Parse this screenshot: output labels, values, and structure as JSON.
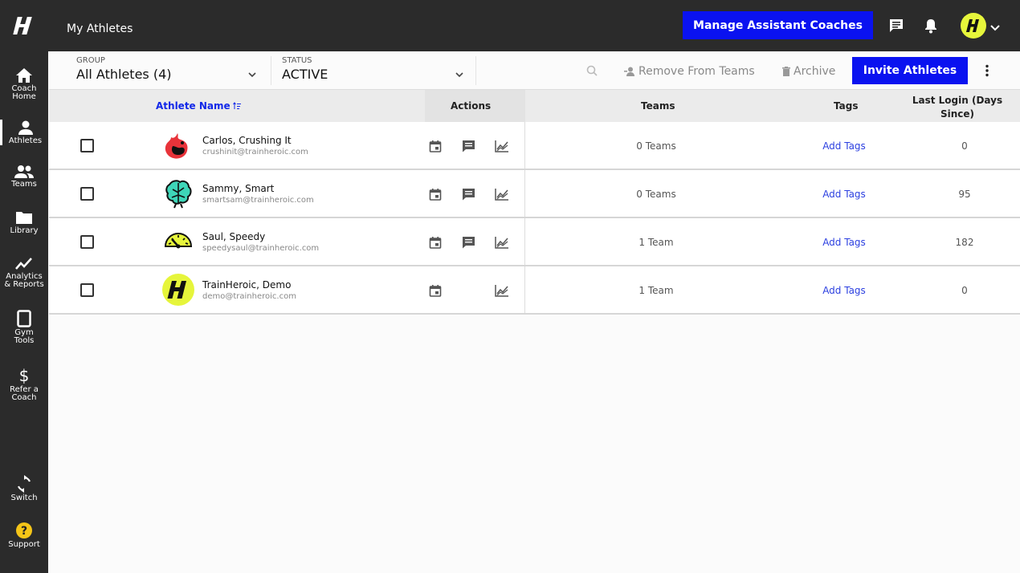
{
  "header": {
    "page_title": "My Athletes",
    "manage_button": "Manage Assistant Coaches"
  },
  "sidebar": {
    "items": [
      {
        "label": "Coach\nHome",
        "icon": "home-icon"
      },
      {
        "label": "Athletes",
        "icon": "person-icon"
      },
      {
        "label": "Teams",
        "icon": "people-icon"
      },
      {
        "label": "Library",
        "icon": "folder-icon"
      },
      {
        "label": "Analytics\n& Reports",
        "icon": "trend-icon"
      },
      {
        "label": "Gym\nTools",
        "icon": "tablet-icon"
      },
      {
        "label": "Refer a\nCoach",
        "icon": "dollar-icon"
      },
      {
        "label": "Switch",
        "icon": "switch-icon"
      },
      {
        "label": "Support",
        "icon": "help-icon"
      }
    ]
  },
  "filters": {
    "group_label": "GROUP",
    "group_value": "All Athletes (4)",
    "status_label": "STATUS",
    "status_value": "ACTIVE"
  },
  "toolbar": {
    "remove_label": "Remove From Teams",
    "archive_label": "Archive",
    "invite_label": "Invite Athletes"
  },
  "table": {
    "headers": {
      "name": "Athlete Name",
      "actions": "Actions",
      "teams": "Teams",
      "tags": "Tags",
      "last_login": "Last Login (Days Since)"
    },
    "rows": [
      {
        "name": "Carlos, Crushing It",
        "email": "crushinit@trainheroic.com",
        "teams": "0 Teams",
        "tags": "Add Tags",
        "last_login": "0",
        "has_message": true
      },
      {
        "name": "Sammy, Smart",
        "email": "smartsam@trainheroic.com",
        "teams": "0 Teams",
        "tags": "Add Tags",
        "last_login": "95",
        "has_message": true
      },
      {
        "name": "Saul, Speedy",
        "email": "speedysaul@trainheroic.com",
        "teams": "1 Team",
        "tags": "Add Tags",
        "last_login": "182",
        "has_message": true
      },
      {
        "name": "TrainHeroic, Demo",
        "email": "demo@trainheroic.com",
        "teams": "1 Team",
        "tags": "Add Tags",
        "last_login": "0",
        "has_message": false
      }
    ]
  },
  "colors": {
    "brand_blue": "#0a12f0",
    "brand_yellow": "#e6f53b",
    "sidebar_bg": "#2b2b2b"
  }
}
